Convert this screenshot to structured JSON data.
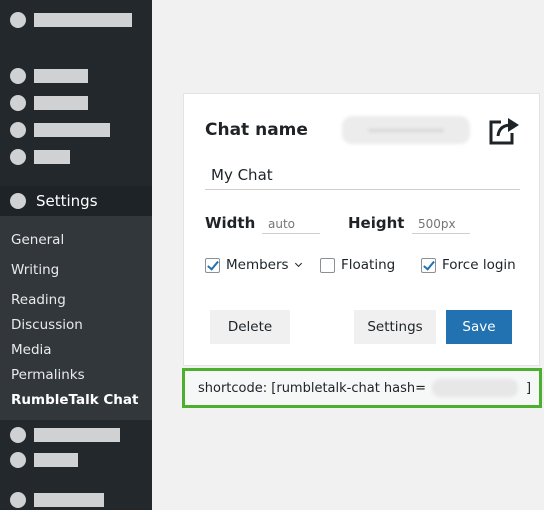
{
  "sidebar": {
    "settings_label": "Settings",
    "submenu": [
      "General",
      "Writing",
      "Reading",
      "Discussion",
      "Media",
      "Permalinks",
      "RumbleTalk Chat"
    ]
  },
  "card": {
    "title": "Chat name",
    "chat_name_value": "My Chat",
    "width_label": "Width",
    "width_placeholder": "auto",
    "height_label": "Height",
    "height_placeholder": "500px",
    "options": [
      {
        "label": "Members",
        "checked": true
      },
      {
        "label": "Floating",
        "checked": false
      },
      {
        "label": "Force login",
        "checked": true
      }
    ],
    "buttons": {
      "delete": "Delete",
      "settings": "Settings",
      "save": "Save"
    }
  },
  "shortcode": {
    "prefix": "shortcode: [rumbletalk-chat hash=",
    "suffix": "]"
  },
  "colors": {
    "sidebar_bg": "#23282d",
    "submenu_bg": "#32373c",
    "primary_button": "#2271b1",
    "highlight_border": "#4caf2e"
  },
  "icons": [
    "share-icon",
    "chevron-down-icon",
    "check-icon"
  ]
}
